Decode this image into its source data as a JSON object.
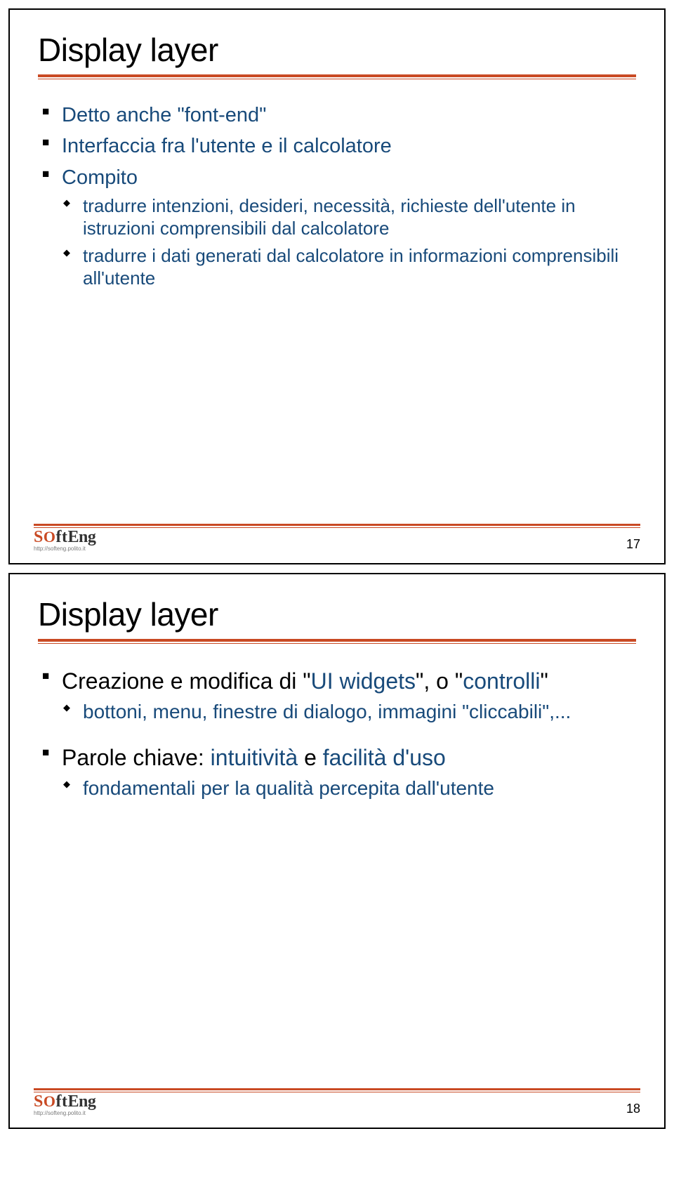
{
  "slides": [
    {
      "title": "Display layer",
      "bullets": [
        {
          "text": "Detto anche \"font-end\""
        },
        {
          "text": "Interfaccia fra l'utente e il calcolatore"
        },
        {
          "text": "Compito",
          "sub": [
            "tradurre intenzioni, desideri, necessità, richieste dell'utente in istruzioni comprensibili dal calcolatore",
            "tradurre i dati generati dal calcolatore in informazioni comprensibili all'utente"
          ]
        }
      ],
      "logo_sub": "http://softeng.polito.it",
      "page": "17"
    },
    {
      "title": "Display layer",
      "bullets2": [
        {
          "pre": "Creazione e modifica di \"",
          "hl1": "UI widgets",
          "mid": "\", o \"",
          "hl2": "controlli",
          "post": "\"",
          "sub": [
            "bottoni, menu, finestre di dialogo, immagini \"cliccabili\",..."
          ]
        },
        {
          "pre": "Parole chiave: ",
          "hl1": "intuitività",
          "mid": " e ",
          "hl2": "facilità d'uso",
          "post": "",
          "sub": [
            {
              "pre": "fondamentali per la ",
              "hl": "qualità percepita",
              "post": " dall'utente"
            }
          ]
        }
      ],
      "logo_sub": "http://softeng.polito.it",
      "page": "18"
    }
  ],
  "logo": {
    "s": "S",
    "o": "O",
    "ft": "ft",
    "eng": "Eng"
  }
}
